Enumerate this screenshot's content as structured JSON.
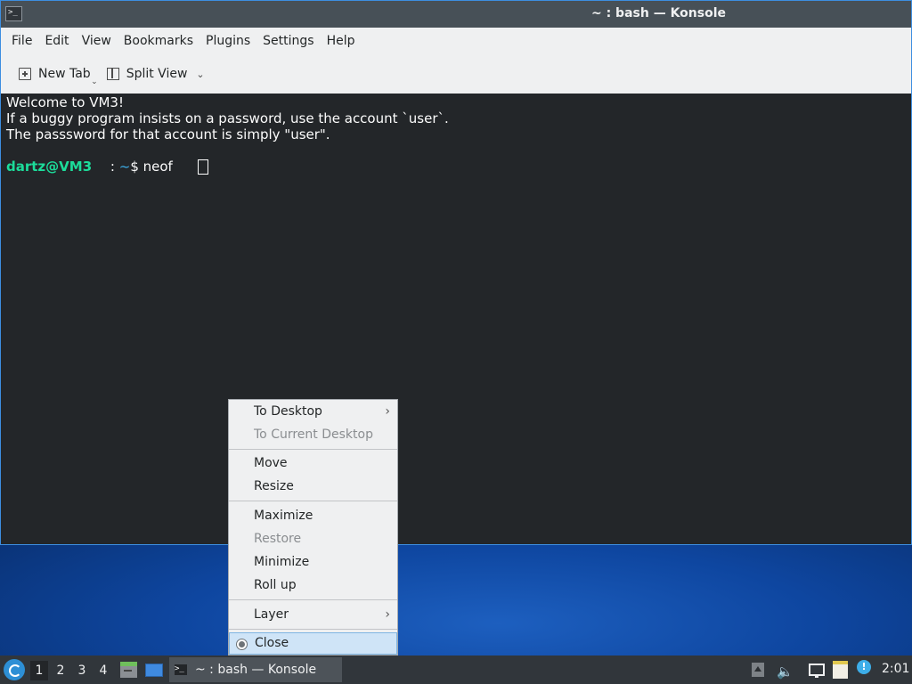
{
  "window": {
    "title": "~ : bash — Konsole",
    "title_icon": "terminal-icon"
  },
  "menubar": {
    "items": [
      "File",
      "Edit",
      "View",
      "Bookmarks",
      "Plugins",
      "Settings",
      "Help"
    ]
  },
  "toolbar": {
    "new_tab_label": "New Tab",
    "split_view_label": "Split View"
  },
  "terminal": {
    "lines": [
      "Welcome to VM3!",
      "If a buggy program insists on a password, use the account `user`.",
      "The passsword for that account is simply \"user\"."
    ],
    "prompt_user": "dartz@VM3",
    "prompt_sep": " : ",
    "prompt_path": "~",
    "prompt_symbol": "$ ",
    "command": "neof",
    "colors": {
      "background": "#232629",
      "user": "#1cdc9a",
      "path": "#3daee9"
    }
  },
  "context_menu": {
    "items": [
      {
        "label": "To Desktop",
        "submenu": true,
        "disabled": false
      },
      {
        "label": "To Current Desktop",
        "submenu": false,
        "disabled": true
      },
      {
        "label": "Move",
        "submenu": false,
        "disabled": false
      },
      {
        "label": "Resize",
        "submenu": false,
        "disabled": false
      },
      {
        "label": "Maximize",
        "submenu": false,
        "disabled": false
      },
      {
        "label": "Restore",
        "submenu": false,
        "disabled": true
      },
      {
        "label": "Minimize",
        "submenu": false,
        "disabled": false
      },
      {
        "label": "Roll up",
        "submenu": false,
        "disabled": false
      },
      {
        "label": "Layer",
        "submenu": true,
        "disabled": false
      },
      {
        "label": "Close",
        "submenu": false,
        "disabled": false,
        "selected": true
      }
    ]
  },
  "taskbar": {
    "desktops": [
      "1",
      "2",
      "3",
      "4"
    ],
    "active_desktop": "1",
    "task_label": "~ : bash — Konsole",
    "clock": "2:01"
  }
}
